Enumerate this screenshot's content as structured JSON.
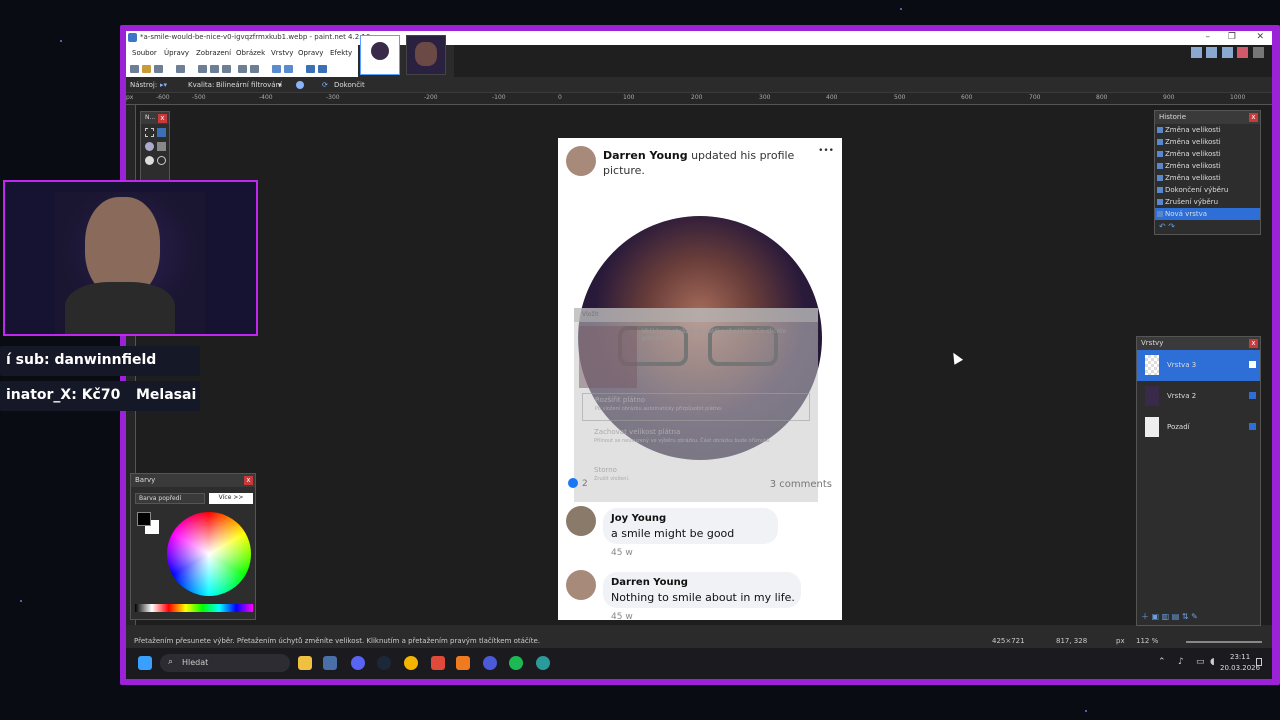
{
  "window": {
    "title": "*a-smile-would-be-nice-v0-igvqzfrmxkub1.webp - paint.net 4.2.16",
    "minimize": "–",
    "maximize": "❐",
    "close": "✕"
  },
  "menu": [
    "Soubor",
    "Úpravy",
    "Zobrazení",
    "Obrázek",
    "Vrstvy",
    "Opravy",
    "Efekty"
  ],
  "toolbar2": {
    "tool_label": "Nástroj:",
    "quality_label": "Kvalita:",
    "quality_value": "Bilineární filtrování",
    "finish_label": "Dokončit"
  },
  "ruler": {
    "unit": "px",
    "ticks": [
      "-600",
      "-500",
      "-400",
      "-300",
      "-200",
      "-100",
      "0",
      "100",
      "200",
      "300",
      "400",
      "500",
      "600",
      "700",
      "800",
      "900",
      "1000"
    ]
  },
  "panels": {
    "tools_title": "N...",
    "history": {
      "title": "Historie",
      "items": [
        "Změna velikosti",
        "Změna velikosti",
        "Změna velikosti",
        "Změna velikosti",
        "Změna velikosti",
        "Dokončení výběru",
        "Zrušení výběru",
        "Nová vrstva"
      ]
    },
    "layers": {
      "title": "Vrstvy",
      "items": [
        "Vrstva 3",
        "Vrstva 2",
        "Pozadí"
      ]
    },
    "colors": {
      "title": "Barvy",
      "select_value": "Barva popředí",
      "more_button": "Více >>"
    }
  },
  "post": {
    "author": "Darren Young",
    "action": "updated his profile picture.",
    "more": "•••",
    "reactions": "2",
    "comments_count": "3 comments",
    "comments": [
      {
        "name": "Joy Young",
        "text": "a smile might be good",
        "time": "45 w"
      },
      {
        "name": "Darren Young",
        "text": "Nothing to smile about in my life.",
        "time": "45 w"
      }
    ]
  },
  "dialog": {
    "title": "Vložit",
    "message": "Vkládaný obrázek je větší než plátno. Co chcete provést?",
    "option1_title": "Rozšířit plátno",
    "option1_desc": "Po vložení obrázku automaticky přizpůsobit plátno.",
    "option2_title": "Zachovat velikost plátna",
    "option2_desc": "Přilnout se neusuzený ve výběru obrázku. Část obrázku bude oříznutá.",
    "cancel_title": "Storno",
    "cancel_desc": "Zrušit vložení."
  },
  "statusbar": {
    "hint": "Přetažením přesunete výběr. Přetažením úchytů změníte velikost. Kliknutím a přetažením pravým tlačítkem otáčíte.",
    "selection_size": "425×721",
    "cursor_pos": "817, 328",
    "unit": "px",
    "zoom": "112 %"
  },
  "taskbar": {
    "search_placeholder": "Hledat",
    "time": "23:11",
    "date": "20.03.2026"
  },
  "overlay": {
    "ticker1": "í sub: danwinnfield",
    "ticker2_a": "inator_X: Kč70",
    "ticker2_b": "Melasai"
  },
  "colors": {
    "frame": "#9b22d6",
    "accent": "#2d6fd6",
    "fb_blue": "#1877f2"
  }
}
